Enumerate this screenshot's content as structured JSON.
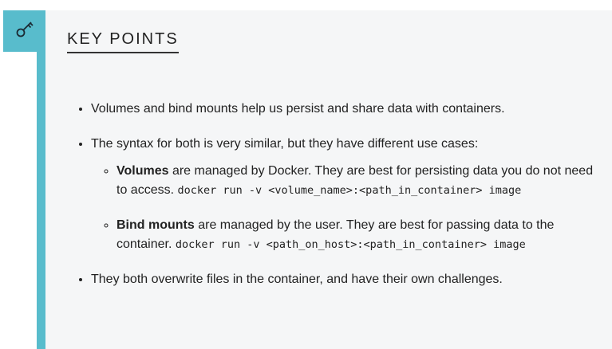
{
  "icon": {
    "name": "key-icon",
    "color": "#58bccc"
  },
  "heading": "KEY POINTS",
  "points": [
    {
      "text": "Volumes and bind mounts help us persist and share data with containers."
    },
    {
      "text": "The syntax for both is very similar, but they have different use cases:",
      "sub": [
        {
          "bold": "Volumes",
          "text": " are managed by Docker. They are best for persisting data you do not need to access. ",
          "code": "docker run -v <volume_name>:<path_in_container> image"
        },
        {
          "bold": "Bind mounts",
          "text": " are managed by the user. They are best for passing data to the container. ",
          "code": "docker run -v <path_on_host>:<path_in_container> image"
        }
      ]
    },
    {
      "text": "They both overwrite files in the container, and have their own challenges."
    }
  ]
}
